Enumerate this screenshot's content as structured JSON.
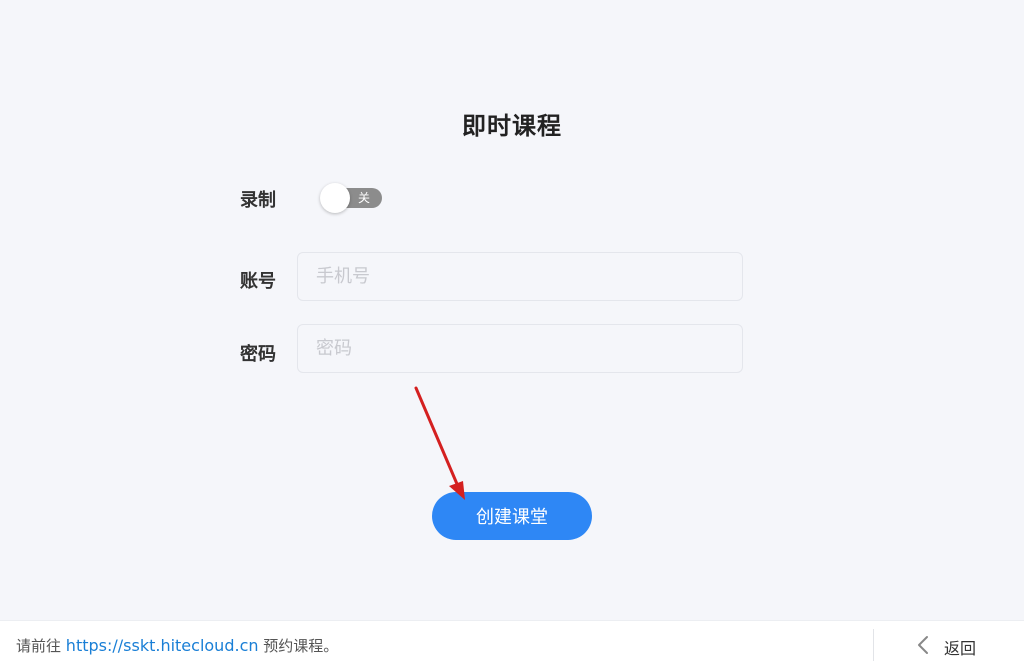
{
  "page": {
    "title": "即时课程"
  },
  "form": {
    "record_label": "录制",
    "record_toggle": {
      "state_text": "关",
      "on": false
    },
    "account_label": "账号",
    "account_placeholder": "手机号",
    "account_value": "",
    "password_label": "密码",
    "password_placeholder": "密码",
    "password_value": "",
    "create_button_label": "创建课堂"
  },
  "footer": {
    "note_prefix": "请前往",
    "link_text": "https://sskt.hitecloud.cn",
    "note_suffix": "预约课程。",
    "back_label": "返回"
  },
  "colors": {
    "background": "#f5f6fa",
    "primary_button": "#2e87f5",
    "link": "#1a7fd6",
    "toggle_off": "#8c8c8c",
    "annotation_arrow": "#d42020"
  },
  "icons": {
    "back": "chevron-left-icon"
  }
}
